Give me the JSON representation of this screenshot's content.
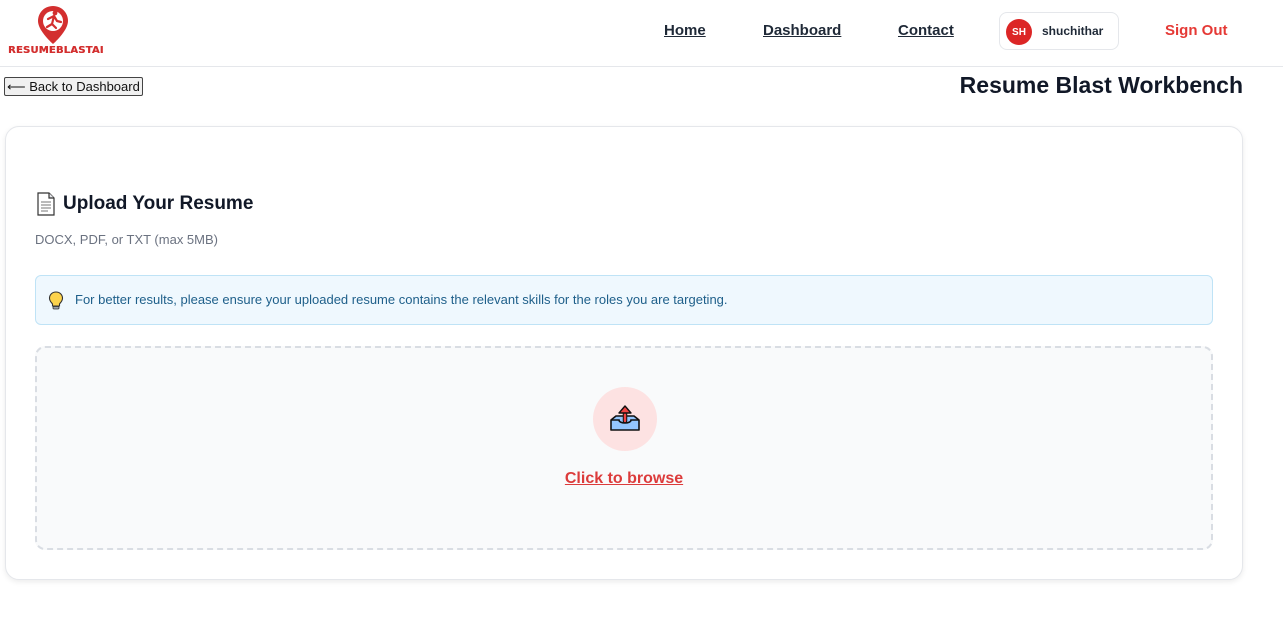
{
  "brand": {
    "logo_text": "RESUMEBLASTAI",
    "logo_icon": "runner-pin-icon",
    "accent_color": "#dc2626"
  },
  "nav": {
    "home": "Home",
    "dashboard": "Dashboard",
    "contact": "Contact",
    "user_initials": "SH",
    "username": "shuchithar",
    "signout": "Sign Out"
  },
  "page": {
    "back_label": "⟵ Back to Dashboard",
    "title": "Resume Blast Workbench"
  },
  "upload": {
    "icon": "document-icon",
    "title": "Upload Your Resume",
    "subtitle": "DOCX, PDF, or TXT (max 5MB)",
    "tip_icon": "lightbulb-icon",
    "tip_text": "For better results, please ensure your uploaded resume contains the relevant skills for the roles you are targeting.",
    "dropzone_icon": "outbox-tray-icon",
    "browse_label": "Click to browse"
  }
}
